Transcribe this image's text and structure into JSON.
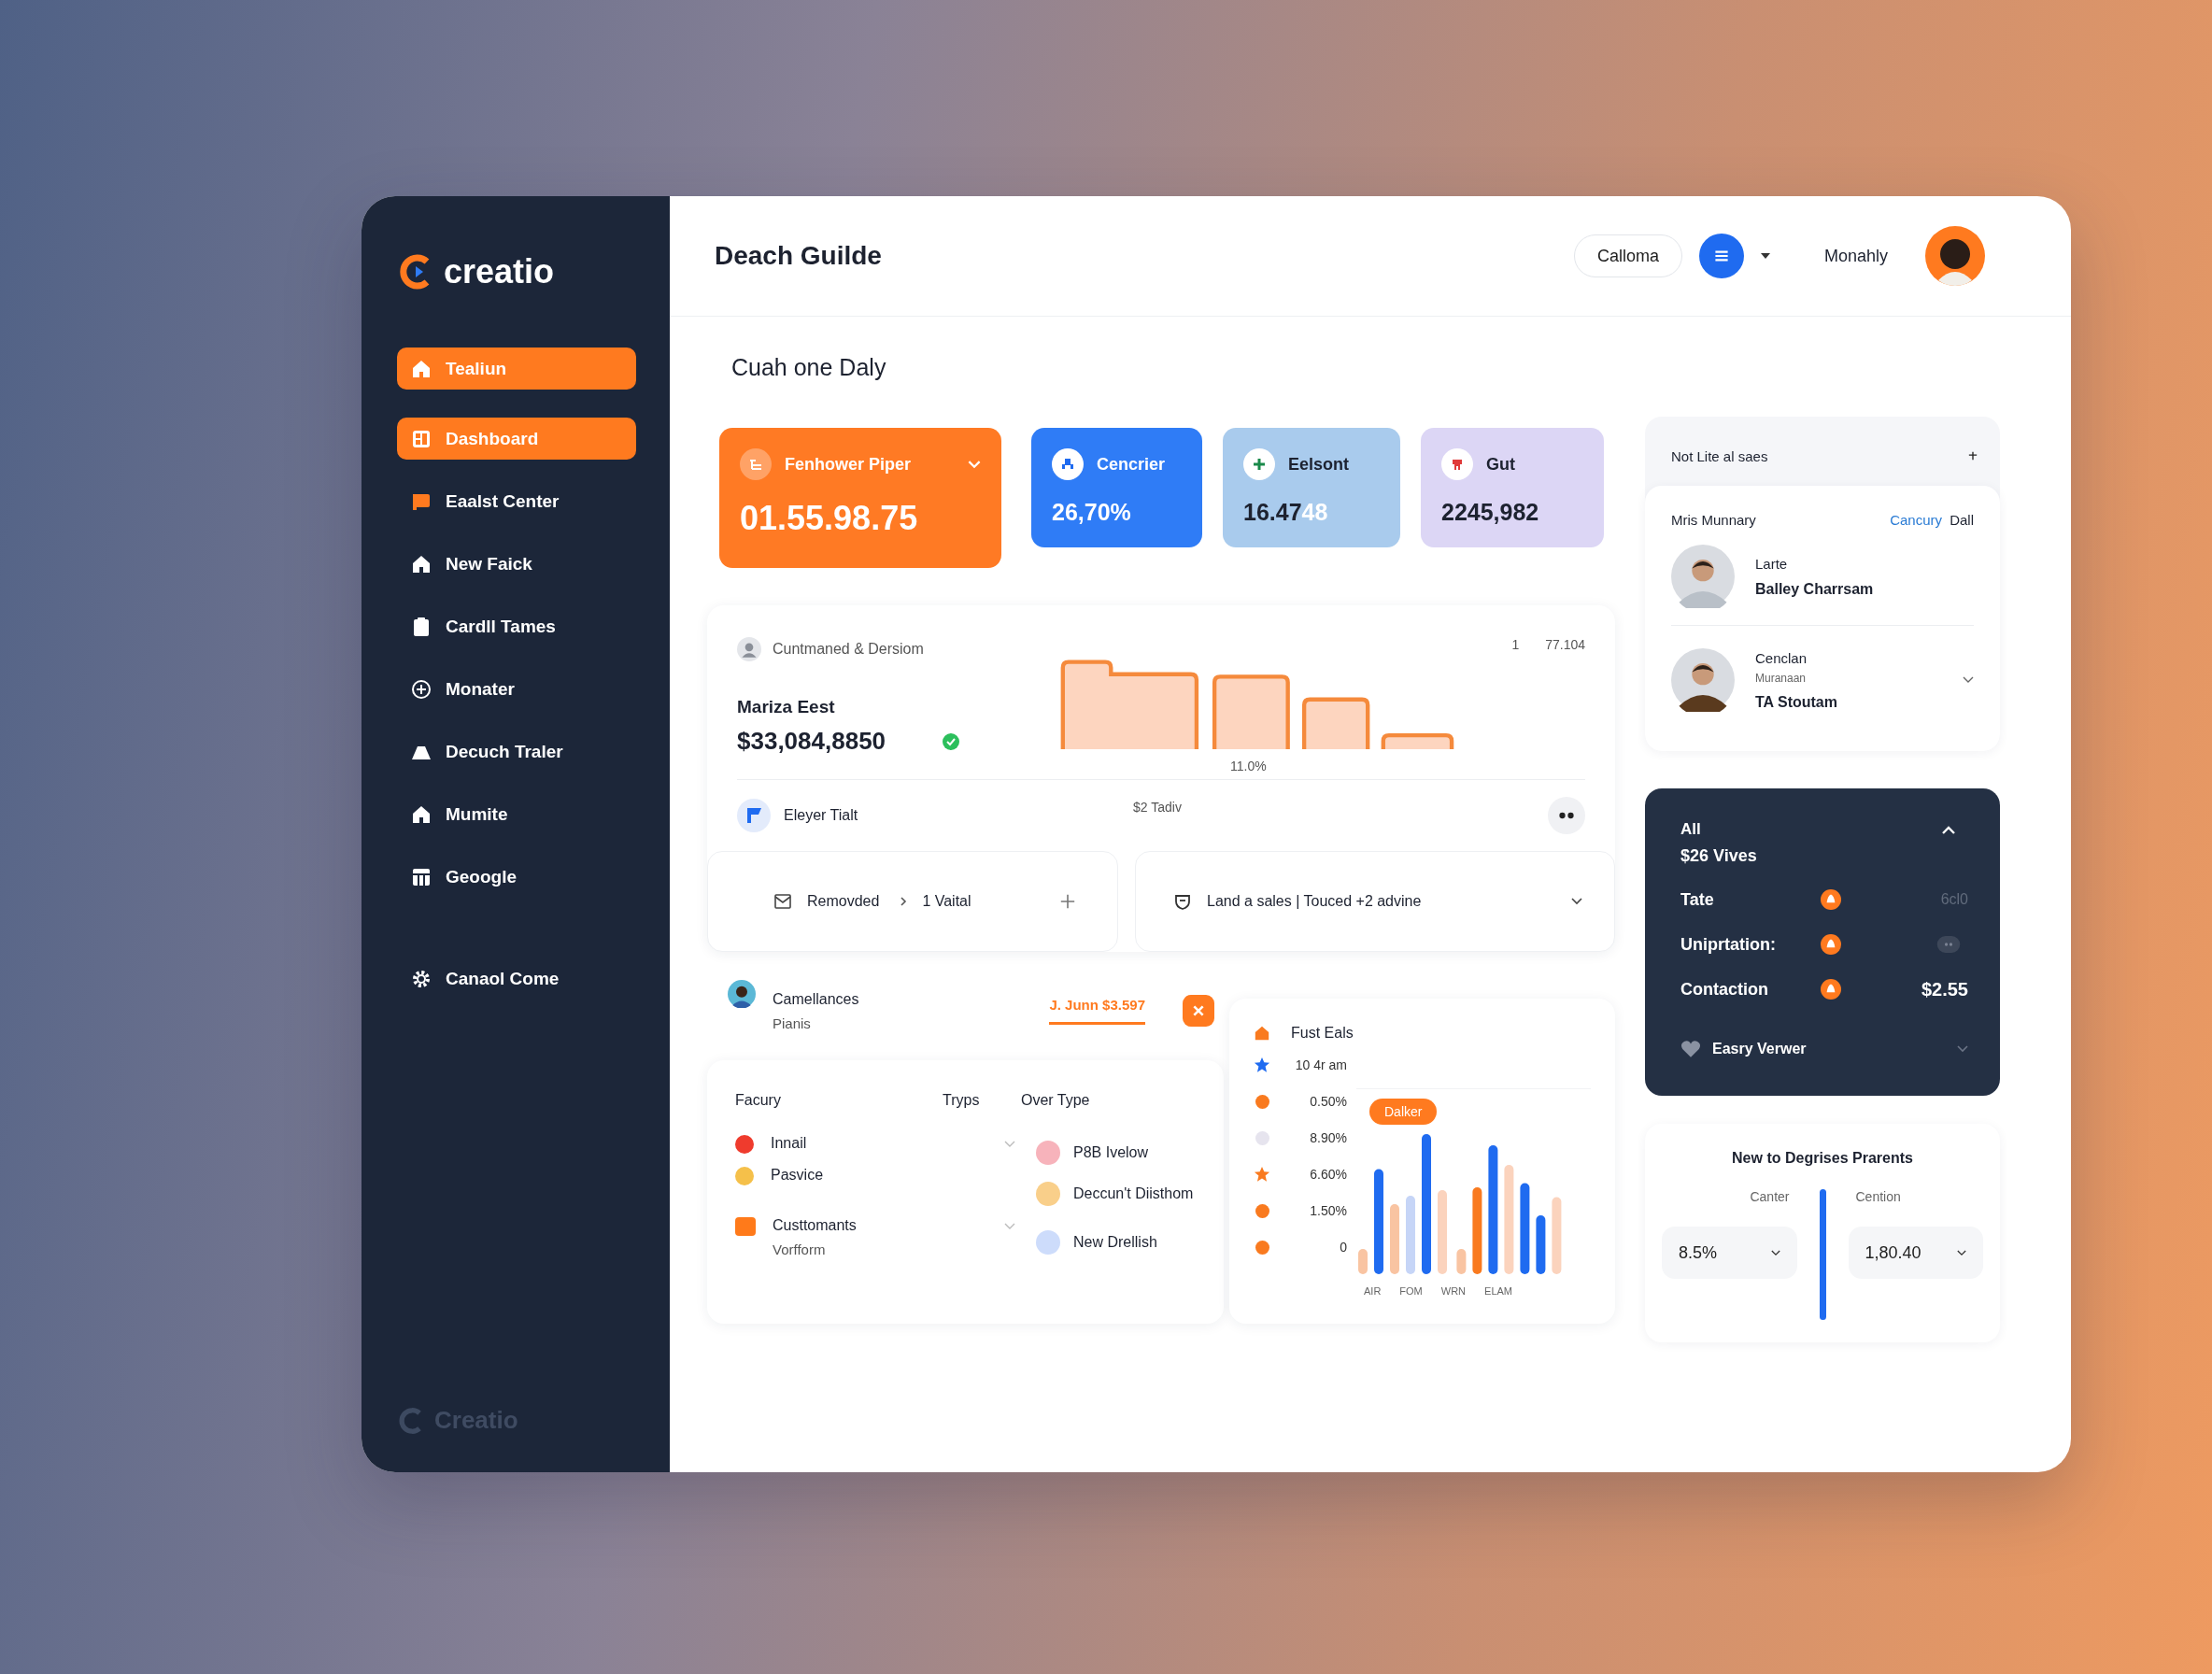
{
  "brand": {
    "name": "creatio",
    "footer_name": "Creatio"
  },
  "sidebar": {
    "items": [
      {
        "label": "Tealiun",
        "selected": true
      },
      {
        "label": "Dashboard",
        "selected": true
      },
      {
        "label": "Eaalst Center",
        "selected": false
      },
      {
        "label": "New Faick",
        "selected": false
      },
      {
        "label": "Cardll Tames",
        "selected": false
      },
      {
        "label": "Monater",
        "selected": false
      },
      {
        "label": "Decuch Traler",
        "selected": false
      },
      {
        "label": "Mumite",
        "selected": false
      },
      {
        "label": "Geoogle",
        "selected": false
      }
    ],
    "footer_item": {
      "label": "Canaol Come"
    }
  },
  "header": {
    "title": "Deach Guilde",
    "pill": "Calloma",
    "user": "Monahly"
  },
  "page_heading": "Cuah one Daly",
  "stat_cards": [
    {
      "kind": "orange",
      "title": "Fenhower Piper",
      "value": "01.55.98.75"
    },
    {
      "kind": "blue",
      "title": "Cencrier",
      "value": "26,70%"
    },
    {
      "kind": "sky",
      "title": "Eelsont",
      "value": "16.47",
      "value_extra": "48"
    },
    {
      "kind": "lilac",
      "title": "Gut",
      "value": "2245,982"
    }
  ],
  "sales_card": {
    "subtitle": "Cuntmaned & Dersiom",
    "name": "Mariza Eest",
    "amount": "$33,084,8850",
    "top_labels": [
      "1",
      "77.104"
    ],
    "bottom_label": "11.0%",
    "row": {
      "label": "Eleyer Tialt",
      "note": "$2 Tadiv"
    },
    "removed_panel": {
      "label": "Removded",
      "detail": "1 Vaital"
    },
    "sales_panel": {
      "label": "Land a sales | Touced +2 advine"
    }
  },
  "contact_row": {
    "name": "Camellances",
    "sub": "Pianis",
    "amount": "J. Junn $3.597"
  },
  "categories_table": {
    "columns": [
      "Facury",
      "Tryps",
      "Over Type"
    ],
    "left_items": [
      {
        "label": "Innail",
        "color": "#ef3b2d"
      },
      {
        "label": "Pasvice",
        "color": "#f5c04a"
      },
      {
        "label": "Custtomants",
        "sub": "Vorfform",
        "color": "#ff7a1a"
      }
    ],
    "right_items": [
      {
        "label": "P8B Ivelow",
        "color": "#f7b3bb"
      },
      {
        "label": "Deccun't Diisthom",
        "color": "#f9cf8a"
      },
      {
        "label": "New Drellish",
        "color": "#cddcfb"
      }
    ]
  },
  "fust_eals": {
    "title": "Fust Eals",
    "badge": "Dalker",
    "categories": [
      "AIR",
      "FOM",
      "WRN",
      "ELAM"
    ],
    "legend": [
      {
        "label": "10 4r am",
        "kind": "star",
        "color": "#1f6bf0"
      },
      {
        "label": "0.50%",
        "kind": "dot",
        "color": "#f97a1f"
      },
      {
        "label": "8.90%",
        "kind": "dot",
        "color": "#e6e4ee"
      },
      {
        "label": "6.60%",
        "kind": "star",
        "color": "#f97a1f"
      },
      {
        "label": "1.50%",
        "kind": "dot",
        "color": "#f97a1f"
      },
      {
        "label": "0",
        "kind": "dot",
        "color": "#f97a1f"
      }
    ]
  },
  "team_panel": {
    "title": "Not Lite al saes",
    "heading": "Mris Munnary",
    "link": "Cancury",
    "link_after": "Dall",
    "people": [
      {
        "role": "Larte",
        "name": "Balley Charrsam"
      },
      {
        "role": "Cenclan",
        "sub": "Muranaan",
        "name": "TA Stoutam"
      }
    ]
  },
  "dark_card": {
    "title": "All",
    "subtitle": "$26 Vives",
    "expanded": true,
    "rows": [
      {
        "label": "Tate",
        "kind": "muted",
        "value": "6cl0"
      },
      {
        "label": "Uniprtation:",
        "kind": "pill"
      },
      {
        "label": "Contaction",
        "kind": "bold",
        "value": "$2.55"
      }
    ],
    "footer": "Easry Verwer"
  },
  "params": {
    "title": "New to Degrises Prarents",
    "left": {
      "label": "Canter",
      "value": "8.5%"
    },
    "right": {
      "label": "Cention",
      "value": "1,80.40"
    }
  }
}
